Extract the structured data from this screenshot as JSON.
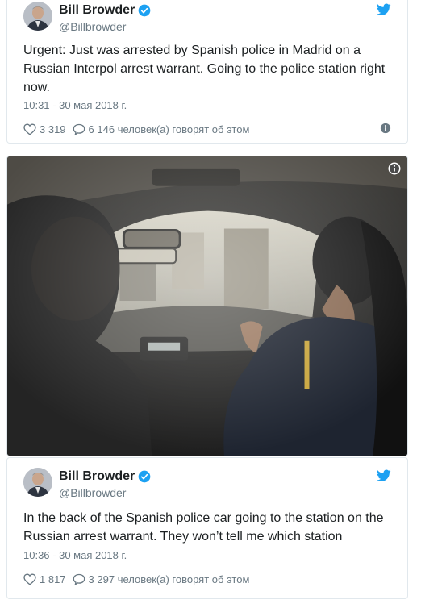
{
  "tweets": [
    {
      "display_name": "Bill Browder",
      "handle": "@Billbrowder",
      "text": "Urgent: Just was arrested by Spanish police in Madrid on a Russian Interpol arrest warrant. Going to the police station right now.",
      "timestamp": "10:31 - 30 мая 2018 г.",
      "likes": "3 319",
      "replies_label": "6 146 человек(а) говорят об этом"
    },
    {
      "display_name": "Bill Browder",
      "handle": "@Billbrowder",
      "text": "In the back of the Spanish police car going to the station on the Russian arrest warrant. They won’t tell me which station",
      "timestamp": "10:36 - 30 мая 2018 г.",
      "likes": "1 817",
      "replies_label": "3 297 человек(а) говорят об этом"
    }
  ],
  "icons": {
    "verified": "verified-badge-icon",
    "twitter": "twitter-bird-icon",
    "like": "heart-icon",
    "reply": "speech-bubble-icon",
    "info": "info-icon"
  },
  "colors": {
    "twitter_blue": "#1da1f2",
    "secondary_text": "#697882",
    "border": "#e1e8ed"
  }
}
